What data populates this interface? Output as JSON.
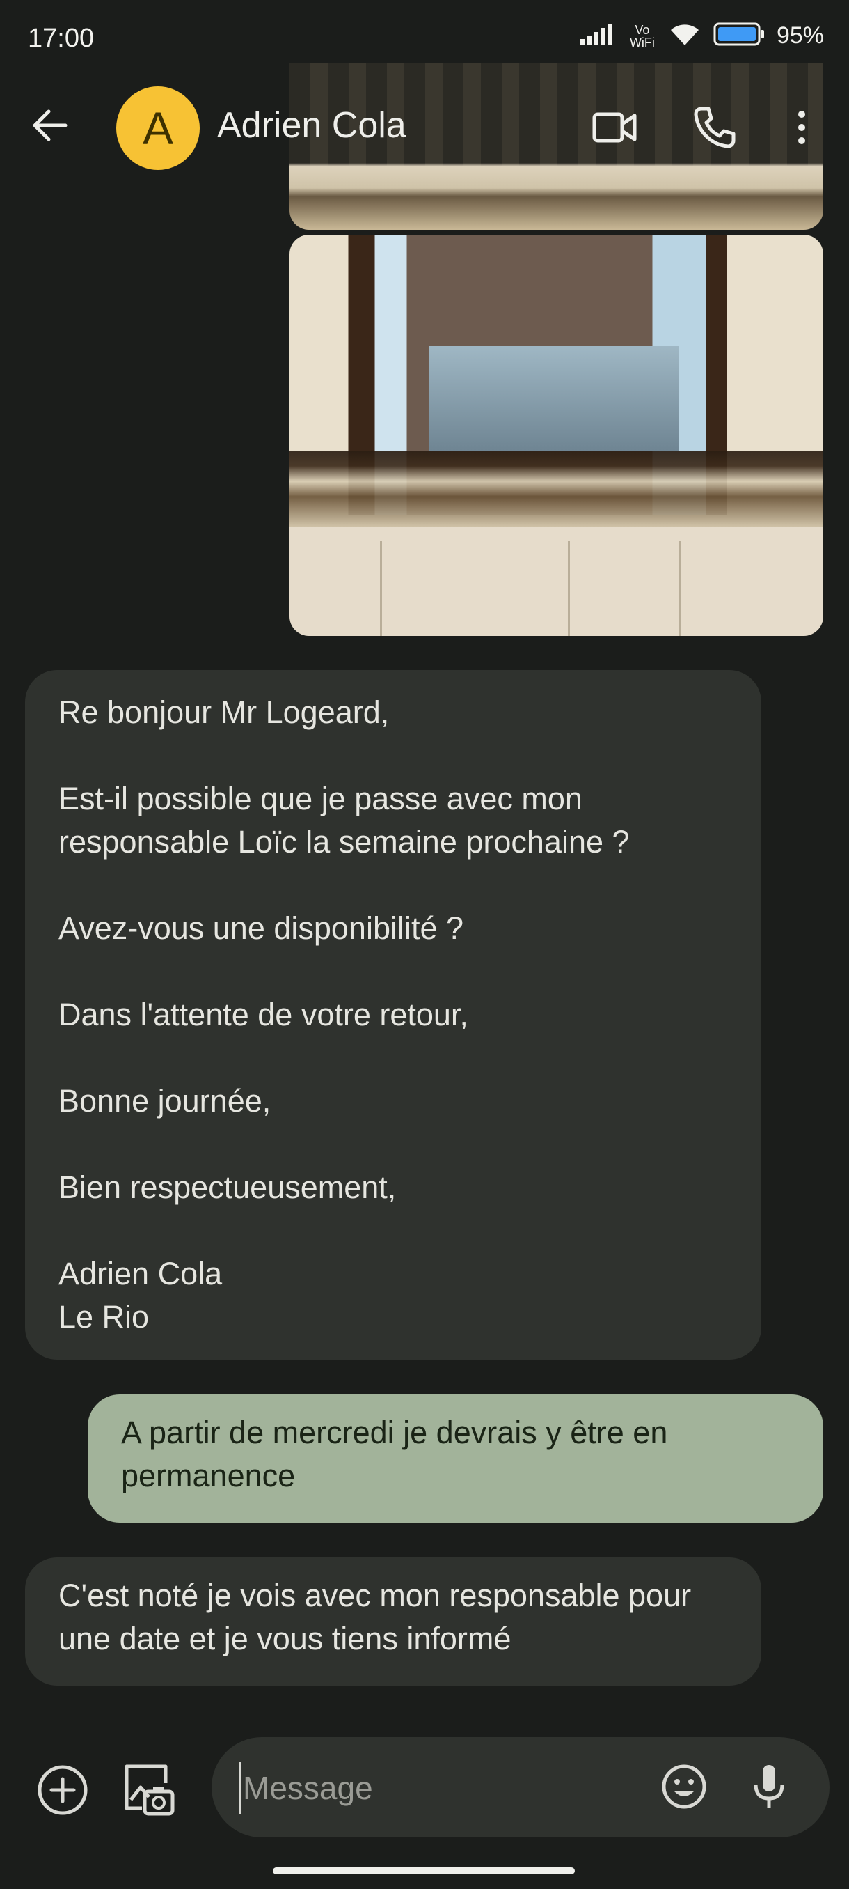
{
  "status_bar": {
    "time": "17:00",
    "vowifi_label": "Vo WiFi",
    "battery_percent": "95%"
  },
  "app_bar": {
    "avatar_letter": "A",
    "contact_name": "Adrien Cola",
    "icons": [
      "back-arrow-icon",
      "video-call-icon",
      "phone-icon",
      "more-vert-icon"
    ]
  },
  "messages": [
    {
      "direction": "incoming",
      "text": "Re bonjour Mr Logeard,\n\nEst-il possible que je passe avec mon responsable Loïc la semaine prochaine ?\n\nAvez-vous une disponibilité ?\n\nDans l'attente de votre retour,\n\nBonne journée,\n\nBien respectueusement,\n\nAdrien Cola\nLe Rio"
    },
    {
      "direction": "outgoing",
      "text": "A partir de mercredi je devrais y être en permanence"
    },
    {
      "direction": "incoming",
      "text": "C'est noté je vois avec mon responsable pour une date et je vous tiens informé"
    }
  ],
  "composer": {
    "placeholder": "Message",
    "icons": [
      "add-circle-icon",
      "gallery-icon",
      "emoji-icon",
      "mic-icon"
    ]
  },
  "colors": {
    "background": "#1b1d1b",
    "incoming_bubble": "#2f322e",
    "outgoing_bubble": "#a2b39a",
    "avatar": "#f7c234"
  }
}
